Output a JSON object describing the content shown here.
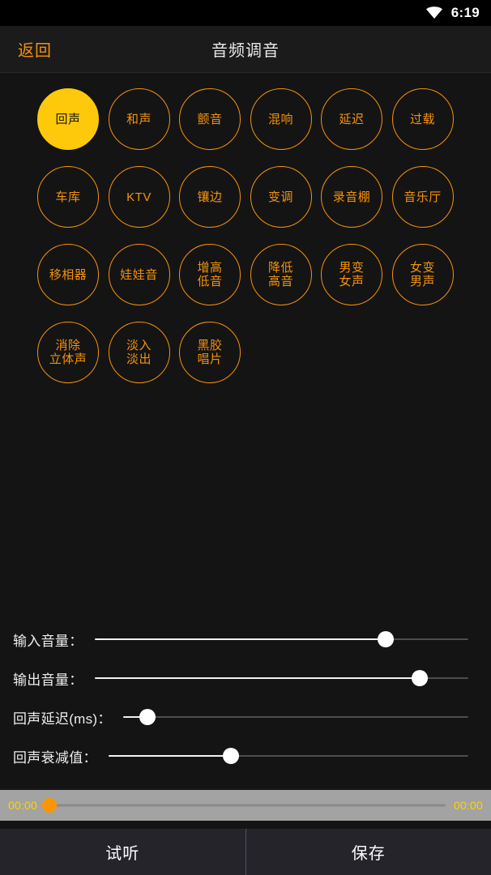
{
  "statusbar": {
    "wifi_icon": "wifi-icon",
    "time": "6:19"
  },
  "titlebar": {
    "back_label": "返回",
    "title": "音频调音"
  },
  "colors": {
    "accent_orange": "#f5920b",
    "selected_yellow": "#ffc90b",
    "page_background": "#141414",
    "player_bar_background": "#a3a3a3",
    "player_time_yellow": "#ffd400",
    "player_thumb_orange": "#ff9500",
    "bottom_bar_background": "#26242b",
    "slider_fill": "#f2f2f2",
    "slider_track": "#4d4d4d"
  },
  "effects": {
    "selected_index": 0,
    "items": [
      {
        "label": "回声",
        "selected": true
      },
      {
        "label": "和声",
        "selected": false
      },
      {
        "label": "颤音",
        "selected": false
      },
      {
        "label": "混响",
        "selected": false
      },
      {
        "label": "延迟",
        "selected": false
      },
      {
        "label": "过载",
        "selected": false
      },
      {
        "label": "车库",
        "selected": false
      },
      {
        "label": "KTV",
        "selected": false
      },
      {
        "label": "镶边",
        "selected": false
      },
      {
        "label": "变调",
        "selected": false
      },
      {
        "label": "录音棚",
        "selected": false
      },
      {
        "label": "音乐厅",
        "selected": false
      },
      {
        "label": "移相器",
        "selected": false
      },
      {
        "label": "娃娃音",
        "selected": false
      },
      {
        "label": "增高\n低音",
        "selected": false
      },
      {
        "label": "降低\n高音",
        "selected": false
      },
      {
        "label": "男变\n女声",
        "selected": false
      },
      {
        "label": "女变\n男声",
        "selected": false
      },
      {
        "label": "消除\n立体声",
        "selected": false
      },
      {
        "label": "淡入\n淡出",
        "selected": false
      },
      {
        "label": "黑胶\n唱片",
        "selected": false
      }
    ]
  },
  "sliders": [
    {
      "label": "输入音量：",
      "percent": 78
    },
    {
      "label": "输出音量：",
      "percent": 87
    },
    {
      "label": "回声延迟(ms)：",
      "percent": 7
    },
    {
      "label": "回声衰减值：",
      "percent": 34
    }
  ],
  "player": {
    "current_time": "00:00",
    "total_time": "00:00",
    "progress_percent": 1
  },
  "bottom": {
    "preview_label": "试听",
    "save_label": "保存"
  }
}
